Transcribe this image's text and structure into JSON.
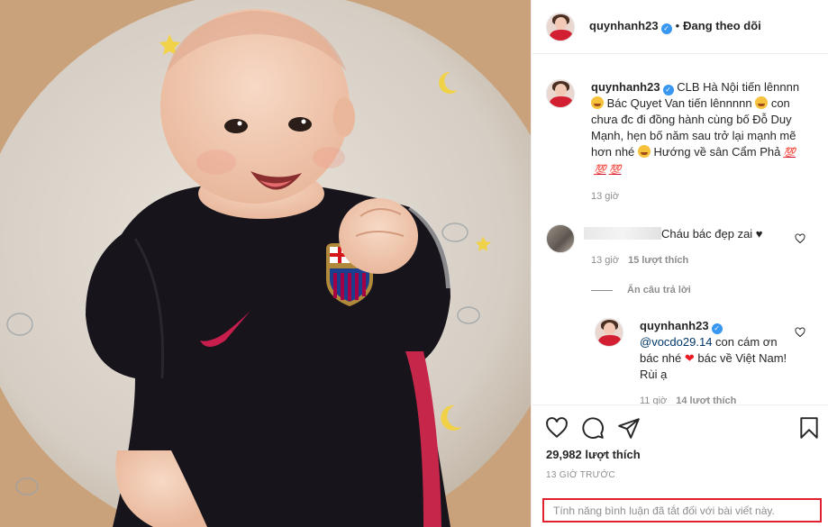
{
  "header": {
    "username": "quynhanh23",
    "separator": "•",
    "follow_status": "Đang theo dõi"
  },
  "caption": {
    "username": "quynhanh23",
    "line1": "CLB Hà Nội tiến lênnnn",
    "line2": "Bác Quyet Van tiến lênnnnn",
    "line3": "con chưa đc đi đồng hành cùng bố Đỗ Duy Mạnh, hẹn bố năm sau trở lại mạnh mẽ hơn nhé",
    "line4": "Hướng về sân Cẩm Phả",
    "emoji_100": "💯",
    "time": "13 giờ"
  },
  "comment1": {
    "text": "Cháu bác đẹp zai ♥",
    "time": "13 giờ",
    "likes": "15 lượt thích",
    "hide_replies": "Ẩn câu trả lời"
  },
  "reply1": {
    "username": "quynhanh23",
    "mention": "@vocdo29.14",
    "text_a": "con cám ơn bác nhé",
    "text_b": "bác về Việt Nam! Rùi ạ",
    "time": "11 giờ",
    "likes": "14 lượt thích"
  },
  "footer": {
    "likes": "29,982 lượt thích",
    "time_ago": "13 GIỜ TRƯỚC",
    "comments_disabled": "Tính năng bình luận đã tắt đối với bài viết này."
  },
  "icons": {
    "like": "heart-outline-icon",
    "comment": "comment-bubble-icon",
    "share": "paper-plane-icon",
    "save": "bookmark-icon",
    "verified": "verified-badge-icon"
  },
  "colors": {
    "highlight_border": "#e3202f",
    "verified": "#3897f0",
    "muted_text": "#8e8e8e"
  }
}
